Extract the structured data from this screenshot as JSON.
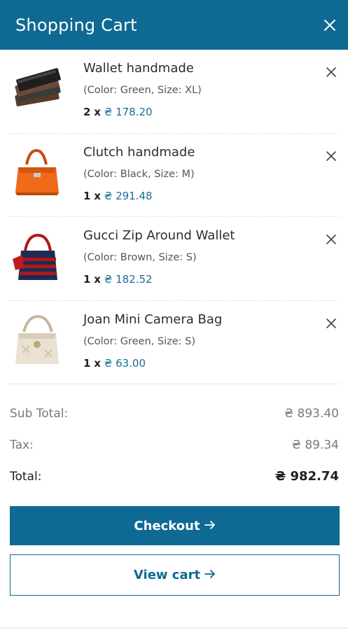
{
  "header": {
    "title": "Shopping Cart",
    "close_icon": "close-icon"
  },
  "items": [
    {
      "name": "Wallet handmade",
      "meta": "(Color: Green, Size: XL)",
      "qty": "2",
      "x": "x",
      "price": "₴ 178.20",
      "thumb": "wallet-stack"
    },
    {
      "name": "Clutch handmade",
      "meta": "(Color: Black, Size: M)",
      "qty": "1",
      "x": "x",
      "price": "₴ 291.48",
      "thumb": "orange-handbag"
    },
    {
      "name": "Gucci Zip Around Wallet",
      "meta": "(Color: Brown, Size: S)",
      "qty": "1",
      "x": "x",
      "price": "₴ 182.52",
      "thumb": "red-navy-bag"
    },
    {
      "name": "Joan Mini Camera Bag",
      "meta": "(Color: Green, Size: S)",
      "qty": "1",
      "x": "x",
      "price": "₴ 63.00",
      "thumb": "beige-bag"
    }
  ],
  "totals": {
    "subtotal_label": "Sub Total:",
    "subtotal_value": "₴ 893.40",
    "tax_label": "Tax:",
    "tax_value": "₴ 89.34",
    "total_label": "Total:",
    "total_value": "₴ 982.74"
  },
  "buttons": {
    "checkout": "Checkout",
    "view_cart": "View cart"
  },
  "colors": {
    "primary": "#0e6a93",
    "price": "#1a6e96"
  }
}
